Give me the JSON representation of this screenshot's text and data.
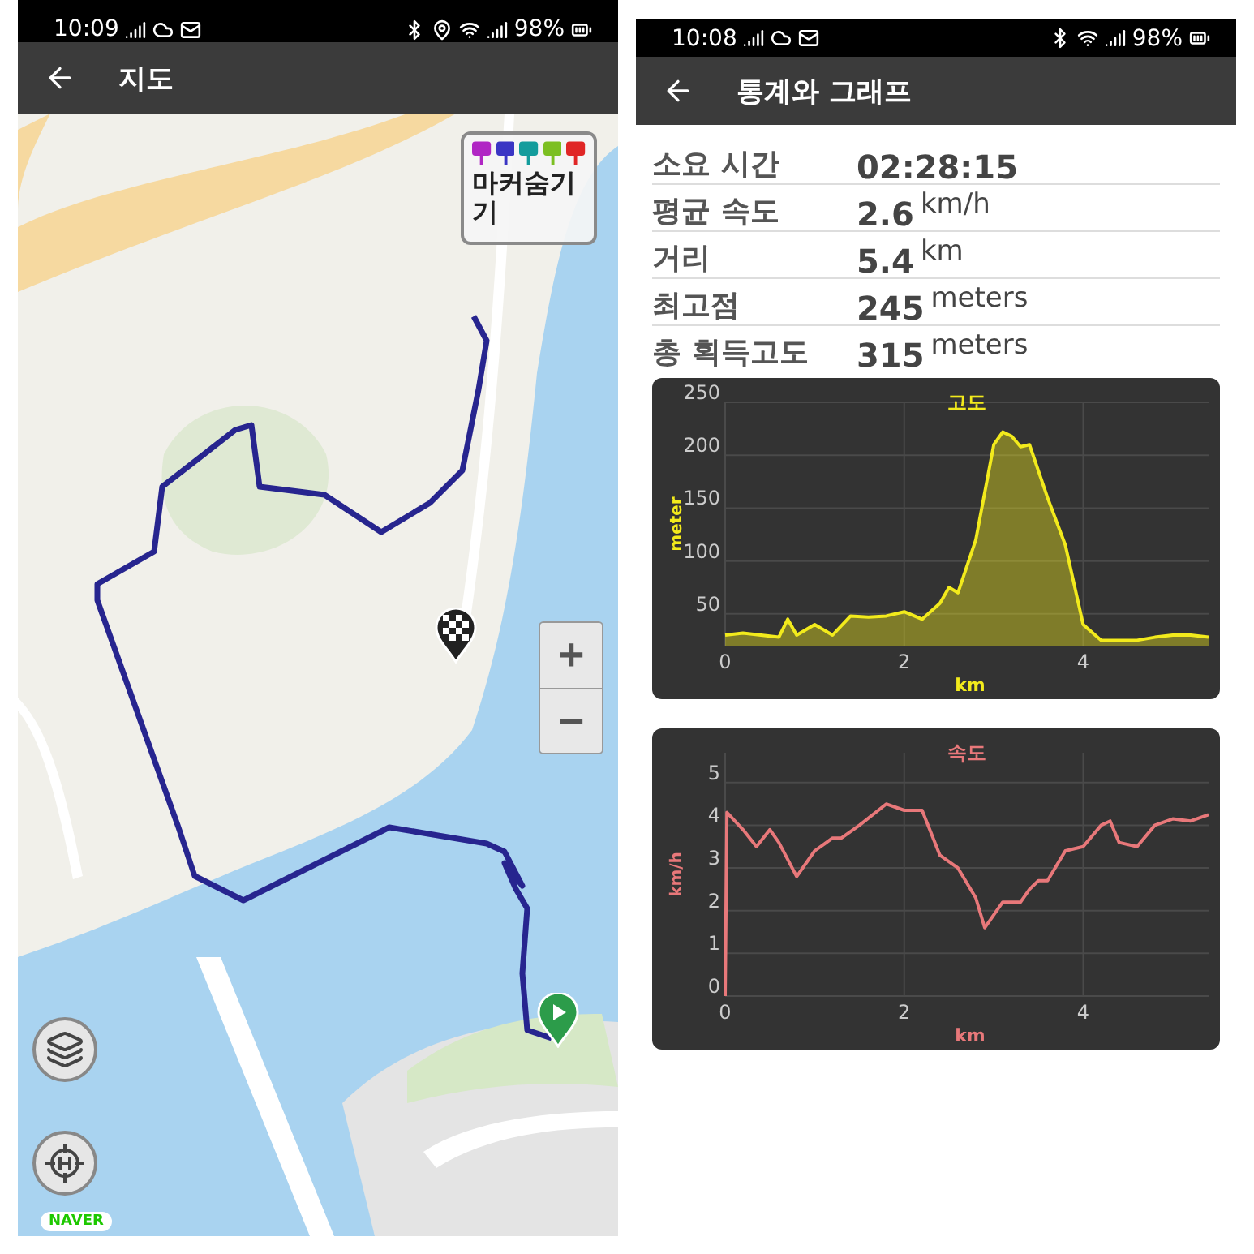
{
  "map_screen": {
    "status_bar": {
      "time": "10:09",
      "battery": "98%"
    },
    "toolbar": {
      "title": "지도"
    },
    "map": {
      "kind": "picture",
      "marker_toggle": {
        "label": "마커숨기기",
        "markers": [
          {
            "color": "#b026c4"
          },
          {
            "color": "#3a35c4"
          },
          {
            "color": "#139c9c"
          },
          {
            "color": "#7cbf22"
          },
          {
            "color": "#e02626"
          }
        ]
      },
      "zoom_in": "+",
      "zoom_out": "−",
      "logo": "NAVER"
    }
  },
  "stats_screen": {
    "status_bar": {
      "time": "10:08",
      "battery": "98%"
    },
    "toolbar": {
      "title": "통계와 그래프"
    },
    "stats": [
      {
        "label": "소요 시간",
        "value": "02:28:15"
      },
      {
        "label": "평균 속도",
        "value": "2.6",
        "unit": "km/h"
      },
      {
        "label": "거리",
        "value": "5.4",
        "unit": "km"
      },
      {
        "label": "최고점",
        "value": "245",
        "unit": "meters"
      },
      {
        "label": "총 획득고도",
        "value": "315",
        "unit": "meters"
      }
    ],
    "charts": [
      {
        "chart_data": {
          "type": "area",
          "grid": true,
          "title": "고도",
          "xlabel": "km",
          "ylabel": "meter",
          "xlim": [
            0,
            5.4
          ],
          "ylim": [
            20,
            250
          ],
          "xticks": [
            0,
            2,
            4
          ],
          "yticks": [
            50,
            100,
            150,
            200,
            250
          ],
          "x": [
            0,
            0.2,
            0.4,
            0.6,
            0.7,
            0.8,
            1.0,
            1.2,
            1.4,
            1.6,
            1.8,
            2.0,
            2.2,
            2.4,
            2.5,
            2.6,
            2.8,
            3.0,
            3.1,
            3.2,
            3.3,
            3.4,
            3.6,
            3.8,
            4.0,
            4.2,
            4.4,
            4.6,
            4.8,
            5.0,
            5.2,
            5.4
          ],
          "series": [
            {
              "color": "#f2ea1c",
              "values": [
                30,
                32,
                30,
                28,
                45,
                30,
                40,
                30,
                48,
                47,
                48,
                52,
                45,
                60,
                75,
                70,
                120,
                210,
                222,
                218,
                208,
                210,
                160,
                115,
                40,
                25,
                25,
                25,
                28,
                30,
                30,
                28
              ]
            }
          ]
        }
      },
      {
        "chart_data": {
          "type": "line",
          "grid": true,
          "title": "속도",
          "xlabel": "km",
          "ylabel": "km/h",
          "xlim": [
            0,
            5.4
          ],
          "ylim": [
            0,
            5.7
          ],
          "xticks": [
            0,
            2,
            4
          ],
          "yticks": [
            0,
            1,
            2,
            3,
            4,
            5
          ],
          "x": [
            0,
            0.02,
            0.2,
            0.35,
            0.5,
            0.6,
            0.8,
            1.0,
            1.2,
            1.3,
            1.5,
            1.8,
            2.0,
            2.2,
            2.4,
            2.6,
            2.8,
            2.9,
            3.1,
            3.3,
            3.4,
            3.5,
            3.6,
            3.8,
            4.0,
            4.2,
            4.3,
            4.4,
            4.6,
            4.8,
            5.0,
            5.2,
            5.4
          ],
          "series": [
            {
              "color": "#e8787a",
              "values": [
                0,
                4.3,
                3.9,
                3.5,
                3.9,
                3.6,
                2.8,
                3.4,
                3.7,
                3.7,
                4.0,
                4.5,
                4.35,
                4.35,
                3.3,
                3.0,
                2.3,
                1.6,
                2.2,
                2.2,
                2.5,
                2.7,
                2.7,
                3.4,
                3.5,
                4.0,
                4.1,
                3.6,
                3.5,
                4.0,
                4.15,
                4.1,
                4.25
              ]
            }
          ]
        }
      }
    ]
  }
}
